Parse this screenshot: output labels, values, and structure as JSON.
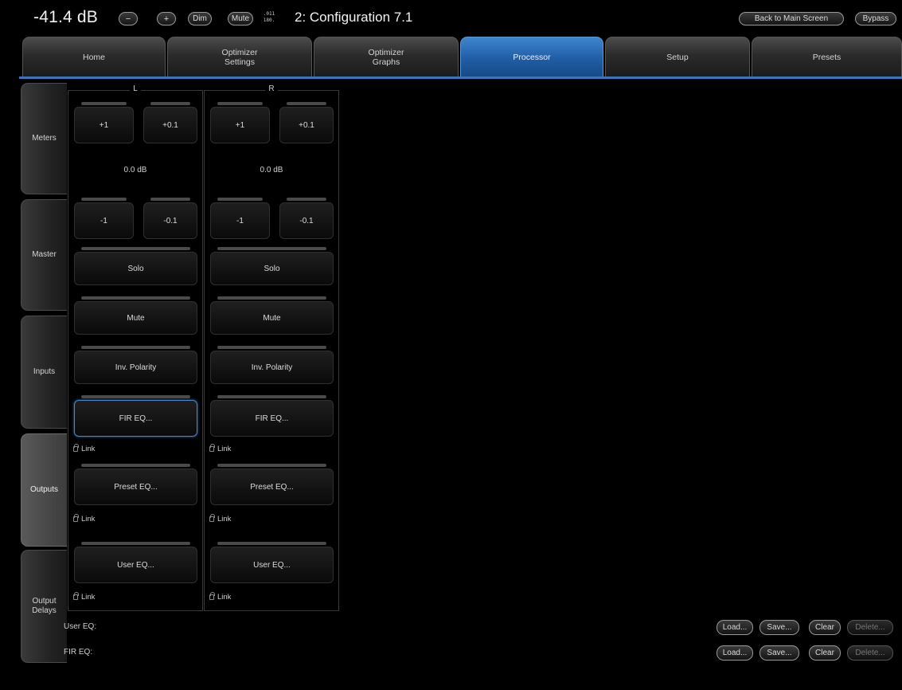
{
  "header": {
    "level": "-41.4 dB",
    "vol_down_symbol": "−",
    "vol_up_symbol": "+",
    "dim_label": "Dim",
    "mute_label": "Mute",
    "format_top": ".011",
    "format_bottom": "180.",
    "configuration": "2: Configuration 7.1",
    "back_label": "Back to Main Screen",
    "bypass_label": "Bypass"
  },
  "tabs": {
    "home": "Home",
    "opt_settings_1": "Optimizer",
    "opt_settings_2": "Settings",
    "opt_graphs_1": "Optimizer",
    "opt_graphs_2": "Graphs",
    "processor": "Processor",
    "setup": "Setup",
    "presets": "Presets"
  },
  "sidebar": {
    "meters": "Meters",
    "master": "Master",
    "inputs": "Inputs",
    "outputs": "Outputs",
    "delays_1": "Output",
    "delays_2": "Delays"
  },
  "channels": [
    {
      "name": "L",
      "plus1": "+1",
      "plus01": "+0.1",
      "gain": "0.0 dB",
      "minus1": "-1",
      "minus01": "-0.1",
      "solo": "Solo",
      "mute": "Mute",
      "polarity": "Inv. Polarity",
      "fir": "FIR EQ...",
      "preset_eq": "Preset EQ...",
      "user_eq": "User EQ...",
      "link": "Link"
    },
    {
      "name": "R",
      "plus1": "+1",
      "plus01": "+0.1",
      "gain": "0.0 dB",
      "minus1": "-1",
      "minus01": "-0.1",
      "solo": "Solo",
      "mute": "Mute",
      "polarity": "Inv. Polarity",
      "fir": "FIR EQ...",
      "preset_eq": "Preset EQ...",
      "user_eq": "User EQ...",
      "link": "Link"
    }
  ],
  "presets": {
    "user_eq_label": "User EQ:",
    "fir_eq_label": "FIR EQ:",
    "load": "Load...",
    "save": "Save...",
    "clear": "Clear",
    "delete": "Delete..."
  },
  "colors": {
    "accent": "#2a6fc0",
    "background": "#000000"
  }
}
